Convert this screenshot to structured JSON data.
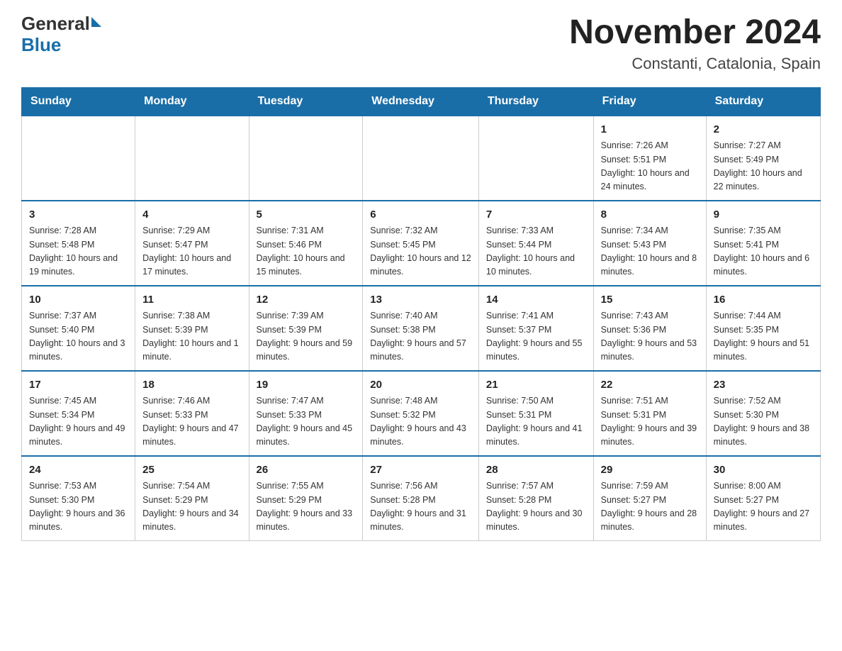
{
  "header": {
    "logo_general": "General",
    "logo_blue": "Blue",
    "title": "November 2024",
    "subtitle": "Constanti, Catalonia, Spain"
  },
  "calendar": {
    "weekdays": [
      "Sunday",
      "Monday",
      "Tuesday",
      "Wednesday",
      "Thursday",
      "Friday",
      "Saturday"
    ],
    "weeks": [
      [
        {
          "day": "",
          "info": ""
        },
        {
          "day": "",
          "info": ""
        },
        {
          "day": "",
          "info": ""
        },
        {
          "day": "",
          "info": ""
        },
        {
          "day": "",
          "info": ""
        },
        {
          "day": "1",
          "info": "Sunrise: 7:26 AM\nSunset: 5:51 PM\nDaylight: 10 hours and 24 minutes."
        },
        {
          "day": "2",
          "info": "Sunrise: 7:27 AM\nSunset: 5:49 PM\nDaylight: 10 hours and 22 minutes."
        }
      ],
      [
        {
          "day": "3",
          "info": "Sunrise: 7:28 AM\nSunset: 5:48 PM\nDaylight: 10 hours and 19 minutes."
        },
        {
          "day": "4",
          "info": "Sunrise: 7:29 AM\nSunset: 5:47 PM\nDaylight: 10 hours and 17 minutes."
        },
        {
          "day": "5",
          "info": "Sunrise: 7:31 AM\nSunset: 5:46 PM\nDaylight: 10 hours and 15 minutes."
        },
        {
          "day": "6",
          "info": "Sunrise: 7:32 AM\nSunset: 5:45 PM\nDaylight: 10 hours and 12 minutes."
        },
        {
          "day": "7",
          "info": "Sunrise: 7:33 AM\nSunset: 5:44 PM\nDaylight: 10 hours and 10 minutes."
        },
        {
          "day": "8",
          "info": "Sunrise: 7:34 AM\nSunset: 5:43 PM\nDaylight: 10 hours and 8 minutes."
        },
        {
          "day": "9",
          "info": "Sunrise: 7:35 AM\nSunset: 5:41 PM\nDaylight: 10 hours and 6 minutes."
        }
      ],
      [
        {
          "day": "10",
          "info": "Sunrise: 7:37 AM\nSunset: 5:40 PM\nDaylight: 10 hours and 3 minutes."
        },
        {
          "day": "11",
          "info": "Sunrise: 7:38 AM\nSunset: 5:39 PM\nDaylight: 10 hours and 1 minute."
        },
        {
          "day": "12",
          "info": "Sunrise: 7:39 AM\nSunset: 5:39 PM\nDaylight: 9 hours and 59 minutes."
        },
        {
          "day": "13",
          "info": "Sunrise: 7:40 AM\nSunset: 5:38 PM\nDaylight: 9 hours and 57 minutes."
        },
        {
          "day": "14",
          "info": "Sunrise: 7:41 AM\nSunset: 5:37 PM\nDaylight: 9 hours and 55 minutes."
        },
        {
          "day": "15",
          "info": "Sunrise: 7:43 AM\nSunset: 5:36 PM\nDaylight: 9 hours and 53 minutes."
        },
        {
          "day": "16",
          "info": "Sunrise: 7:44 AM\nSunset: 5:35 PM\nDaylight: 9 hours and 51 minutes."
        }
      ],
      [
        {
          "day": "17",
          "info": "Sunrise: 7:45 AM\nSunset: 5:34 PM\nDaylight: 9 hours and 49 minutes."
        },
        {
          "day": "18",
          "info": "Sunrise: 7:46 AM\nSunset: 5:33 PM\nDaylight: 9 hours and 47 minutes."
        },
        {
          "day": "19",
          "info": "Sunrise: 7:47 AM\nSunset: 5:33 PM\nDaylight: 9 hours and 45 minutes."
        },
        {
          "day": "20",
          "info": "Sunrise: 7:48 AM\nSunset: 5:32 PM\nDaylight: 9 hours and 43 minutes."
        },
        {
          "day": "21",
          "info": "Sunrise: 7:50 AM\nSunset: 5:31 PM\nDaylight: 9 hours and 41 minutes."
        },
        {
          "day": "22",
          "info": "Sunrise: 7:51 AM\nSunset: 5:31 PM\nDaylight: 9 hours and 39 minutes."
        },
        {
          "day": "23",
          "info": "Sunrise: 7:52 AM\nSunset: 5:30 PM\nDaylight: 9 hours and 38 minutes."
        }
      ],
      [
        {
          "day": "24",
          "info": "Sunrise: 7:53 AM\nSunset: 5:30 PM\nDaylight: 9 hours and 36 minutes."
        },
        {
          "day": "25",
          "info": "Sunrise: 7:54 AM\nSunset: 5:29 PM\nDaylight: 9 hours and 34 minutes."
        },
        {
          "day": "26",
          "info": "Sunrise: 7:55 AM\nSunset: 5:29 PM\nDaylight: 9 hours and 33 minutes."
        },
        {
          "day": "27",
          "info": "Sunrise: 7:56 AM\nSunset: 5:28 PM\nDaylight: 9 hours and 31 minutes."
        },
        {
          "day": "28",
          "info": "Sunrise: 7:57 AM\nSunset: 5:28 PM\nDaylight: 9 hours and 30 minutes."
        },
        {
          "day": "29",
          "info": "Sunrise: 7:59 AM\nSunset: 5:27 PM\nDaylight: 9 hours and 28 minutes."
        },
        {
          "day": "30",
          "info": "Sunrise: 8:00 AM\nSunset: 5:27 PM\nDaylight: 9 hours and 27 minutes."
        }
      ]
    ]
  }
}
